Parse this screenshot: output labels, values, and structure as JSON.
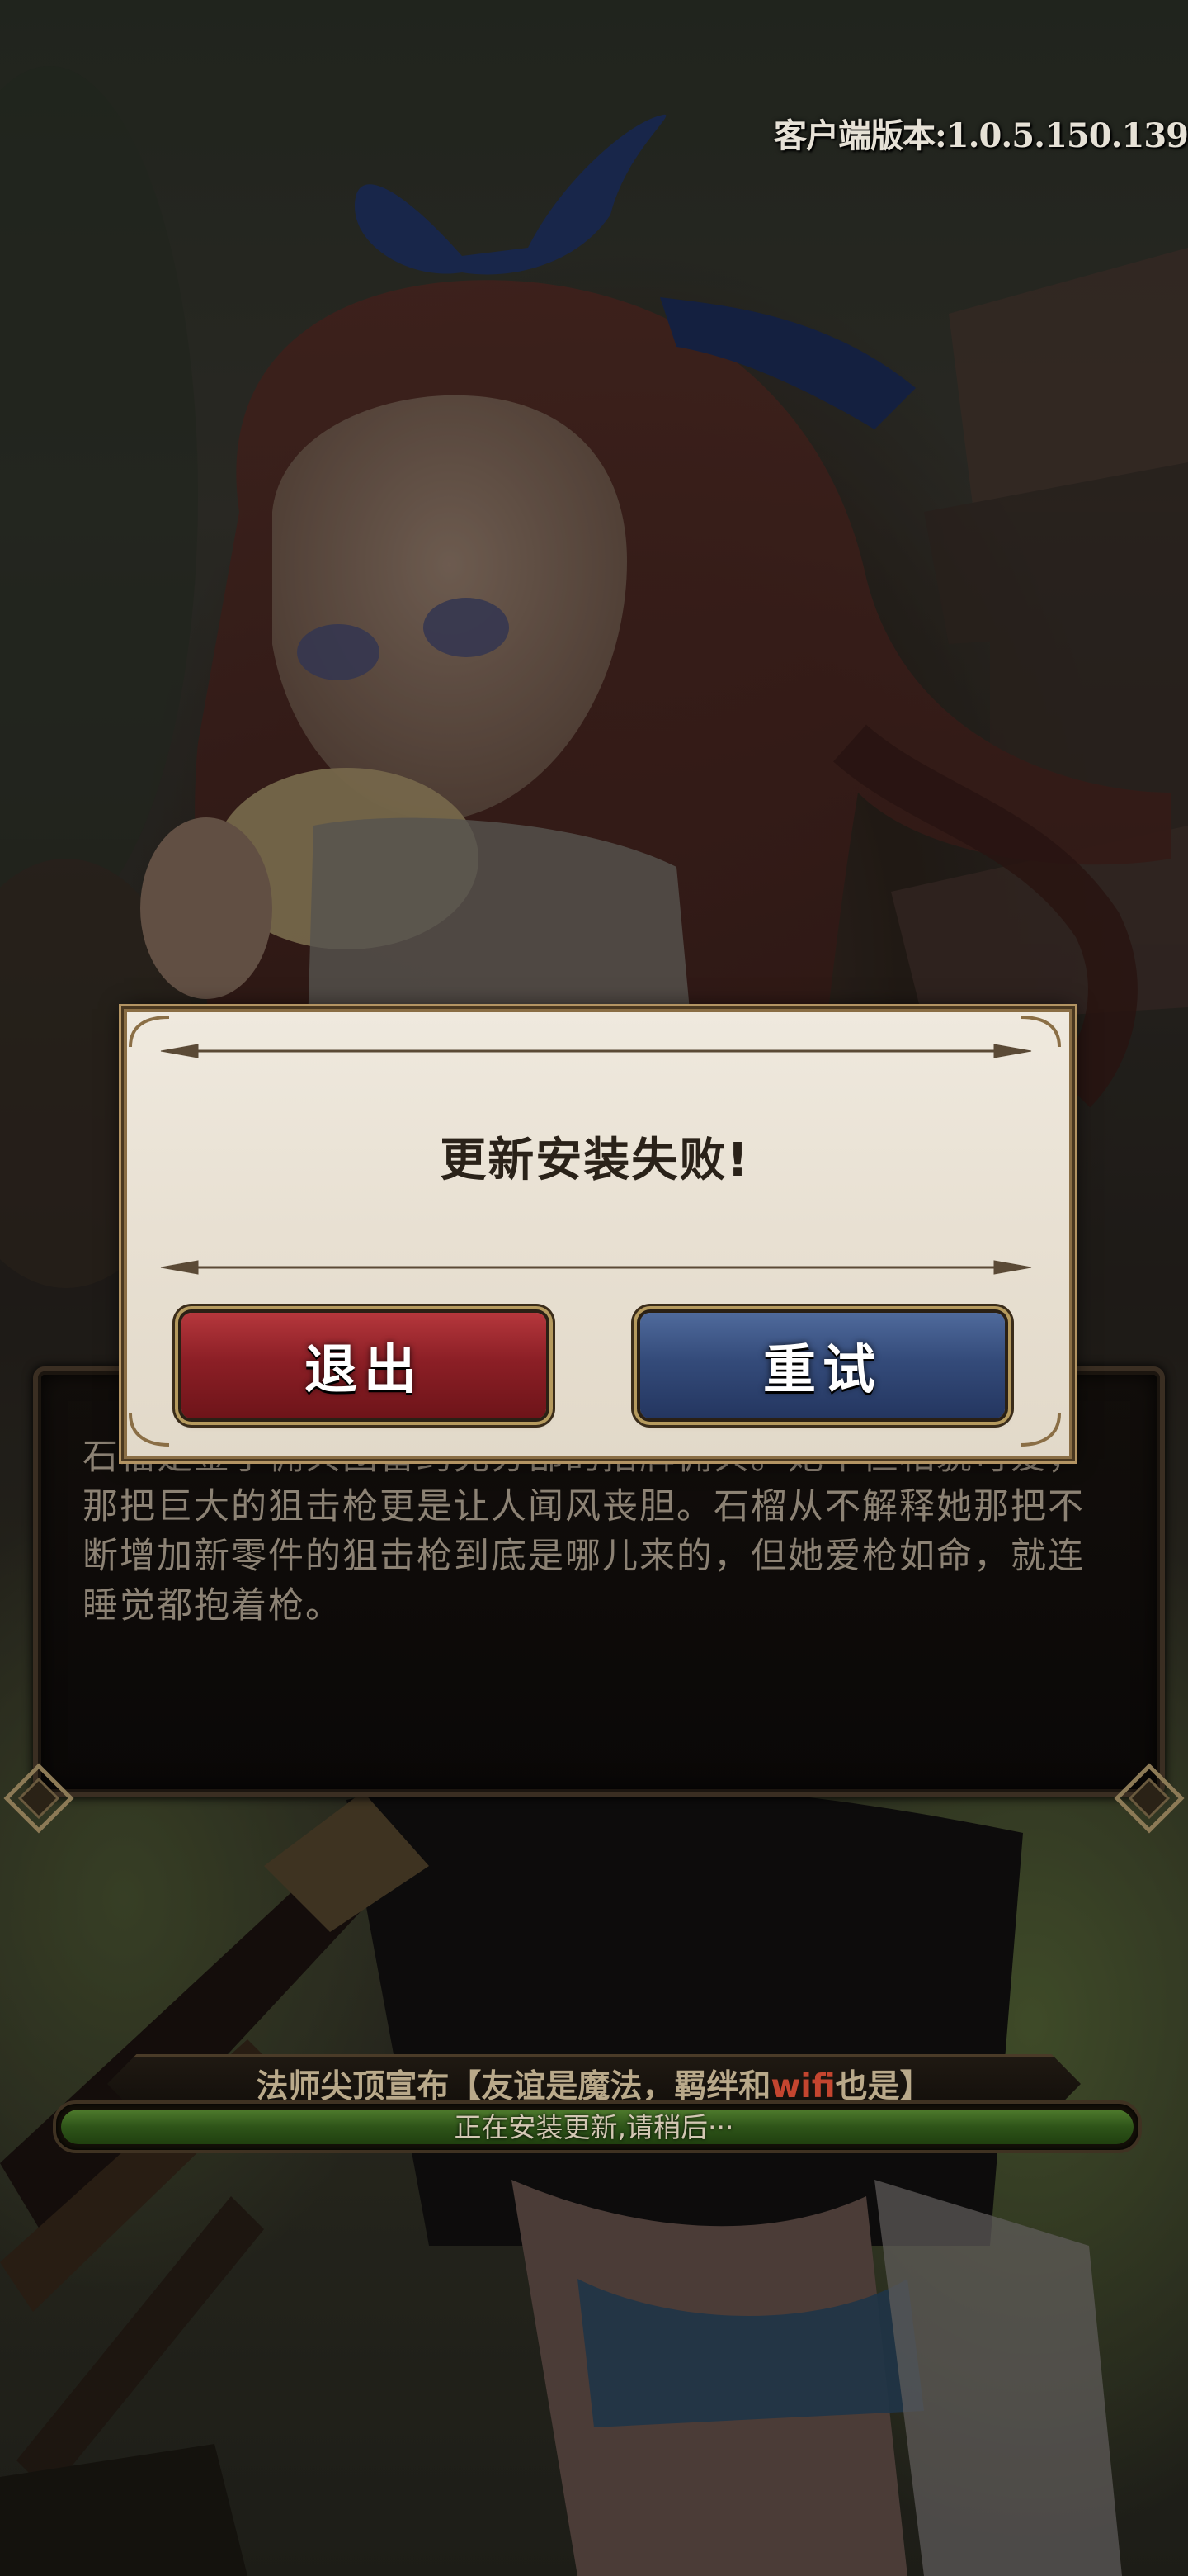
{
  "app": {
    "version_label": "客户端版本:1.0.5.150.139"
  },
  "description": {
    "text": "石榴是金手佣兵团雷约克分部的招牌佣兵。她不但相貌可爱，那把巨大的狙击枪更是让人闻风丧胆。石榴从不解释她那把不断增加新零件的狙击枪到底是哪儿来的，但她爱枪如命，就连睡觉都抱着枪。"
  },
  "dialog": {
    "message": "更新安装失败!",
    "exit_label": "退出",
    "retry_label": "重试"
  },
  "banner": {
    "text_before": "法师尖顶宣布【友谊是魔法，羁绊和",
    "highlight": "wifi",
    "text_after": "也是】"
  },
  "progress": {
    "status_text": "正在安装更新,请稍后···",
    "value": 1.0
  },
  "colors": {
    "exit_button": "#8c1f26",
    "retry_button": "#344b7a",
    "progress_fill": "#2e5419",
    "dialog_bg": "#ece5d9",
    "highlight_text": "#c4452f"
  }
}
